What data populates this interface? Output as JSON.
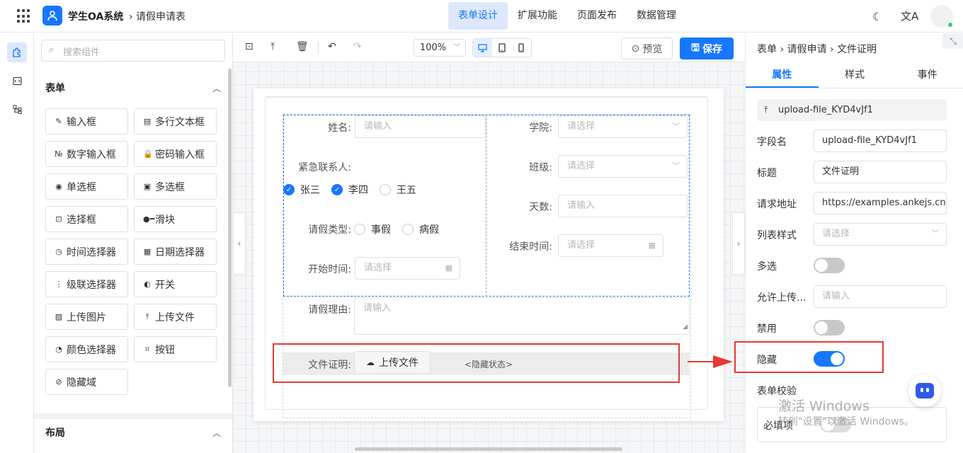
{
  "header": {
    "app_title": "学生OA系统",
    "breadcrumb": "› 请假申请表",
    "nav": [
      "表单设计",
      "扩展功能",
      "页面发布",
      "数据管理"
    ],
    "active_nav": "表单设计",
    "moon_icon": "☾",
    "lang_icon": "文A"
  },
  "rail": {
    "icons": [
      "puzzle-icon",
      "code-icon",
      "tree-icon"
    ]
  },
  "components": {
    "search_placeholder": "搜索组件",
    "form_section": "表单",
    "items": [
      {
        "icon": "✎",
        "label": "输入框"
      },
      {
        "icon": "▤",
        "label": "多行文本框"
      },
      {
        "icon": "№",
        "label": "数字输入框"
      },
      {
        "icon": "🔒",
        "label": "密码输入框"
      },
      {
        "icon": "◉",
        "label": "单选框"
      },
      {
        "icon": "▣",
        "label": "多选框"
      },
      {
        "icon": "⊡",
        "label": "选择框"
      },
      {
        "icon": "●━",
        "label": "滑块"
      },
      {
        "icon": "◷",
        "label": "时间选择器"
      },
      {
        "icon": "▦",
        "label": "日期选择器"
      },
      {
        "icon": "⋮",
        "label": "级联选择器"
      },
      {
        "icon": "◐",
        "label": "开关"
      },
      {
        "icon": "▨",
        "label": "上传图片"
      },
      {
        "icon": "⤒",
        "label": "上传文件"
      },
      {
        "icon": "◔",
        "label": "颜色选择器"
      },
      {
        "icon": "⌗",
        "label": "按钮"
      },
      {
        "icon": "⊘",
        "label": "隐藏域"
      }
    ],
    "layout_section": "布局"
  },
  "toolbar": {
    "zoom": "100%",
    "preview": "预览",
    "save": "保存"
  },
  "form": {
    "name_label": "姓名:",
    "name_placeholder": "请输入",
    "college_label": "学院:",
    "college_placeholder": "请选择",
    "contact_label": "紧急联系人:",
    "contacts": [
      {
        "label": "张三",
        "checked": true
      },
      {
        "label": "李四",
        "checked": true
      },
      {
        "label": "王五",
        "checked": false
      }
    ],
    "class_label": "班级:",
    "class_placeholder": "请选择",
    "days_label": "天数:",
    "days_placeholder": "请输入",
    "leave_type_label": "请假类型:",
    "leave_types": [
      "事假",
      "病假"
    ],
    "end_time_label": "结束时间:",
    "end_time_placeholder": "请选择",
    "start_time_label": "开始时间:",
    "start_time_placeholder": "请选择",
    "reason_label": "请假理由:",
    "reason_placeholder": "请输入",
    "file_label": "文件证明:",
    "upload_button": "上传文件",
    "hidden_tag": "<隐藏状态>"
  },
  "props": {
    "breadcrumb": "表单 › 请假申请 › 文件证明",
    "tabs": [
      "属性",
      "样式",
      "事件"
    ],
    "active_tab": "属性",
    "component_name": "upload-file_KYD4vJf1",
    "field_name_label": "字段名",
    "field_name_value": "upload-file_KYD4vJf1",
    "title_label": "标题",
    "title_value": "文件证明",
    "url_label": "请求地址",
    "url_value": "https://examples.ankejs.cn/",
    "list_style_label": "列表样式",
    "list_style_placeholder": "请选择",
    "multiple_label": "多选",
    "multiple_on": false,
    "allow_label": "允许上传...",
    "allow_placeholder": "请输入",
    "disabled_label": "禁用",
    "disabled_on": false,
    "hidden_label": "隐藏",
    "hidden_on": true,
    "validate_label": "表单校验",
    "required_label": "必填项"
  },
  "watermark": {
    "line1": "激活 Windows",
    "line2": "转到\"设置\"以激活 Windows。"
  },
  "colors": {
    "accent": "#1677ff",
    "highlight": "#e53935"
  }
}
